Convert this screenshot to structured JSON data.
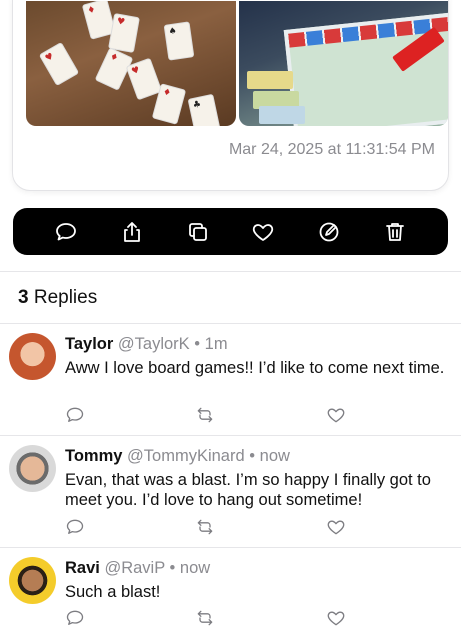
{
  "post": {
    "timestamp": "Mar 24, 2025 at 11:31:54 PM",
    "photos": [
      "photo-playing-cards",
      "photo-monopoly-board"
    ]
  },
  "toolbar": {
    "icons": [
      "comment-icon",
      "share-icon",
      "copy-icon",
      "heart-icon",
      "edit-icon",
      "trash-icon"
    ]
  },
  "replies_header": {
    "count": "3",
    "label": "Replies"
  },
  "replies": [
    {
      "name": "Taylor",
      "handle": "@TaylorK",
      "separator": "•",
      "time": "1m",
      "text": "Aww I love board games!! I’d like to come next time."
    },
    {
      "name": "Tommy",
      "handle": "@TommyKinard",
      "separator": "•",
      "time": "now",
      "text": "Evan, that was a blast. I’m so happy I finally got to meet you. I’d love to hang out sometime!"
    },
    {
      "name": "Ravi",
      "handle": "@RaviP",
      "separator": "•",
      "time": "now",
      "text": "Such a blast!"
    }
  ],
  "colors": {
    "toolbar_bg": "#000000",
    "secondary_text": "#8b8b90",
    "icon_gray": "#7d7d82"
  }
}
